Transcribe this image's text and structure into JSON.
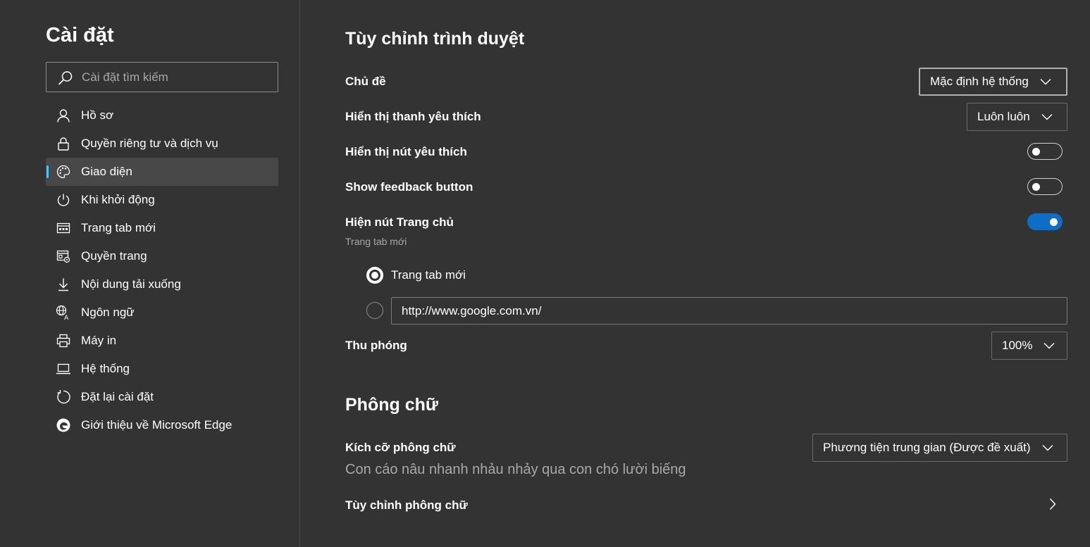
{
  "sidebar": {
    "title": "Cài đặt",
    "search_placeholder": "Cài đặt tìm kiếm",
    "items": [
      {
        "label": "Hồ sơ",
        "icon": "profile-icon"
      },
      {
        "label": "Quyền riêng tư và dịch vụ",
        "icon": "lock-icon"
      },
      {
        "label": "Giao diện",
        "icon": "palette-icon",
        "active": true
      },
      {
        "label": "Khi khởi động",
        "icon": "power-icon"
      },
      {
        "label": "Trang tab mới",
        "icon": "new-tab-icon"
      },
      {
        "label": "Quyền trang",
        "icon": "site-permissions-icon"
      },
      {
        "label": "Nội dung tải xuống",
        "icon": "download-icon"
      },
      {
        "label": "Ngôn ngữ",
        "icon": "language-icon"
      },
      {
        "label": "Máy in",
        "icon": "printer-icon"
      },
      {
        "label": "Hệ thống",
        "icon": "laptop-icon"
      },
      {
        "label": "Đặt lại cài đặt",
        "icon": "reset-icon"
      },
      {
        "label": "Giới thiệu về Microsoft Edge",
        "icon": "edge-logo-icon"
      }
    ]
  },
  "main": {
    "customize_title": "Tùy chỉnh trình duyệt",
    "theme": {
      "label": "Chủ đề",
      "value": "Mặc định hệ thống"
    },
    "favorites_bar": {
      "label": "Hiển thị thanh yêu thích",
      "value": "Luôn luôn"
    },
    "favorites_button": {
      "label": "Hiển thị nút yêu thích",
      "on": false
    },
    "feedback_button": {
      "label": "Show feedback button",
      "on": false
    },
    "home_button": {
      "label": "Hiện nút Trang chủ",
      "sublabel": "Trang tab mới",
      "on": true
    },
    "home_options": {
      "new_tab_label": "Trang tab mới",
      "url_value": "http://www.google.com.vn/"
    },
    "zoom": {
      "label": "Thu phóng",
      "value": "100%"
    },
    "fonts_title": "Phông chữ",
    "font_size": {
      "label": "Kích cỡ phông chữ",
      "value": "Phương tiện trung gian (Được đề xuất)",
      "sample": "Con cáo nâu nhanh nhảu nhảy qua con chó lười biếng"
    },
    "customize_fonts": {
      "label": "Tùy chỉnh phông chữ"
    }
  },
  "colors": {
    "background": "#333333",
    "accent": "#0e6dc6",
    "active_indicator": "#4cc2ff"
  }
}
